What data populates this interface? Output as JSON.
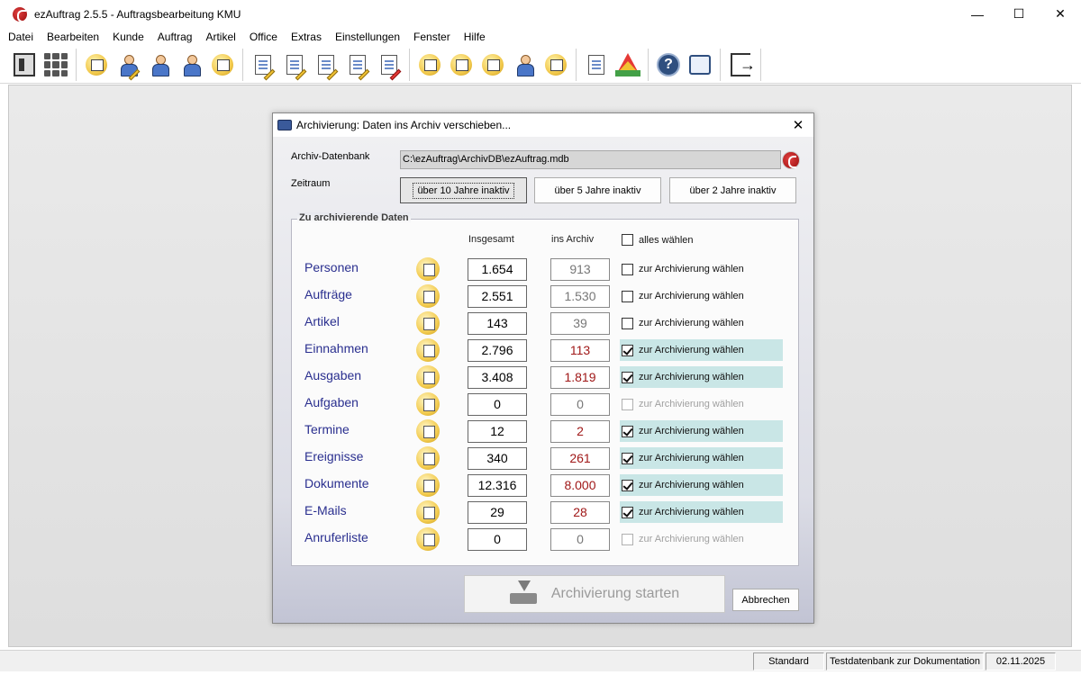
{
  "window": {
    "title": "ezAuftrag 2.5.5  -  Auftragsbearbeitung KMU",
    "minimize": "—",
    "maximize": "☐",
    "close": "✕"
  },
  "menu": [
    "Datei",
    "Bearbeiten",
    "Kunde",
    "Auftrag",
    "Artikel",
    "Office",
    "Extras",
    "Einstellungen",
    "Fenster",
    "Hilfe"
  ],
  "toolbar": {
    "icons": [
      "ledger-icon",
      "grid-icon",
      "new-document-icon",
      "edit-person-icon",
      "person-icon",
      "people-icon",
      "cards-icon",
      "invoice-icon",
      "document-list-icon",
      "document-edit-icon",
      "checklist-icon",
      "alert-document-icon",
      "box-out-icon",
      "box-in-icon",
      "package-icon",
      "courier-icon",
      "tasks-icon",
      "report-icon",
      "traffic-triangle-icon",
      "help-icon",
      "chat-icon",
      "exit-icon"
    ]
  },
  "dialog": {
    "title": "Archivierung: Daten ins Archiv verschieben...",
    "close": "✕",
    "db_label": "Archiv-Datenbank",
    "db_path": "C:\\ezAuftrag\\ArchivDB\\ezAuftrag.mdb",
    "range_label": "Zeitraum",
    "ranges": [
      "über 10 Jahre inaktiv",
      "über 5 Jahre inaktiv",
      "über 2 Jahre inaktiv"
    ],
    "active_range_index": 0,
    "group_title": "Zu archivierende Daten",
    "col_total": "Insgesamt",
    "col_archive": "ins Archiv",
    "select_all": "alles wählen",
    "rows": [
      {
        "name": "Personen",
        "total": "1.654",
        "archive": "913",
        "checked": false,
        "enabled": true,
        "label": "zur Archivierung wählen",
        "icon": "person-icon"
      },
      {
        "name": "Aufträge",
        "total": "2.551",
        "archive": "1.530",
        "checked": false,
        "enabled": true,
        "label": "zur Archivierung wählen",
        "icon": "order-icon"
      },
      {
        "name": "Artikel",
        "total": "143",
        "archive": "39",
        "checked": false,
        "enabled": true,
        "label": "zur Archivierung wählen",
        "icon": "article-icon"
      },
      {
        "name": "Einnahmen",
        "total": "2.796",
        "archive": "113",
        "checked": true,
        "enabled": true,
        "label": "zur Archivierung wählen",
        "icon": "income-icon"
      },
      {
        "name": "Ausgaben",
        "total": "3.408",
        "archive": "1.819",
        "checked": true,
        "enabled": true,
        "label": "zur Archivierung wählen",
        "icon": "expense-icon"
      },
      {
        "name": "Aufgaben",
        "total": "0",
        "archive": "0",
        "checked": false,
        "enabled": false,
        "label": "zur Archivierung wählen",
        "icon": "task-icon"
      },
      {
        "name": "Termine",
        "total": "12",
        "archive": "2",
        "checked": true,
        "enabled": true,
        "label": "zur Archivierung wählen",
        "icon": "appointment-icon"
      },
      {
        "name": "Ereignisse",
        "total": "340",
        "archive": "261",
        "checked": true,
        "enabled": true,
        "label": "zur Archivierung wählen",
        "icon": "event-icon"
      },
      {
        "name": "Dokumente",
        "total": "12.316",
        "archive": "8.000",
        "checked": true,
        "enabled": true,
        "label": "zur Archivierung wählen",
        "icon": "document-icon"
      },
      {
        "name": "E-Mails",
        "total": "29",
        "archive": "28",
        "checked": true,
        "enabled": true,
        "label": "zur Archivierung wählen",
        "icon": "email-icon"
      },
      {
        "name": "Anruferliste",
        "total": "0",
        "archive": "0",
        "checked": false,
        "enabled": false,
        "label": "zur Archivierung wählen",
        "icon": "call-list-icon"
      }
    ],
    "start_button": "Archivierung starten",
    "cancel_button": "Abbrechen"
  },
  "statusbar": {
    "mode": "Standard",
    "database": "Testdatenbank zur Dokumentation",
    "date": "02.11.2025"
  }
}
